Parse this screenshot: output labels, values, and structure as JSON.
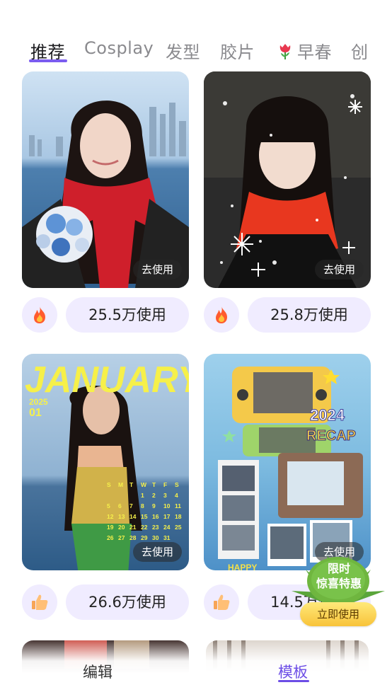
{
  "tabs": [
    {
      "label": "推荐",
      "active": true
    },
    {
      "label": "Cosplay",
      "active": false
    },
    {
      "label": "发型",
      "active": false
    },
    {
      "label": "胶片",
      "active": false
    },
    {
      "label": "早春",
      "active": false,
      "icon": "tulip-icon"
    },
    {
      "label": "创",
      "active": false
    }
  ],
  "cards": [
    {
      "use_label": "去使用",
      "count": "25.5万使用",
      "badge_icon": "fire-icon"
    },
    {
      "use_label": "去使用",
      "count": "25.8万使用",
      "badge_icon": "fire-icon"
    },
    {
      "use_label": "去使用",
      "count": "26.6万使用",
      "badge_icon": "thumbs-up-icon",
      "art_text": {
        "title": "JANUARY",
        "year": "2025",
        "month": "01",
        "weekdays": [
          "S",
          "M",
          "T",
          "W",
          "T",
          "F",
          "S"
        ],
        "days": [
          "1",
          "2",
          "3",
          "4",
          "5",
          "6",
          "7",
          "8",
          "9",
          "10",
          "11",
          "12",
          "13",
          "14",
          "15",
          "16",
          "17",
          "18",
          "19",
          "20",
          "21",
          "22",
          "23",
          "24",
          "25",
          "26",
          "27",
          "28",
          "29",
          "30",
          "31"
        ]
      }
    },
    {
      "use_label": "去使用",
      "count": "14.5万使用",
      "badge_icon": "thumbs-up-icon",
      "art_text": {
        "year": "2024",
        "recap": "RECAP",
        "happy": "HAPPY"
      }
    }
  ],
  "promo": {
    "line1": "限时",
    "line2": "惊喜特惠",
    "button": "立即使用"
  },
  "bottom_nav": [
    {
      "label": "编辑",
      "active": false
    },
    {
      "label": "模板",
      "active": true
    }
  ],
  "colors": {
    "accent": "#7b5cf0",
    "badge_bg": "#f0ecff",
    "promo_button": "#f8c33a"
  }
}
